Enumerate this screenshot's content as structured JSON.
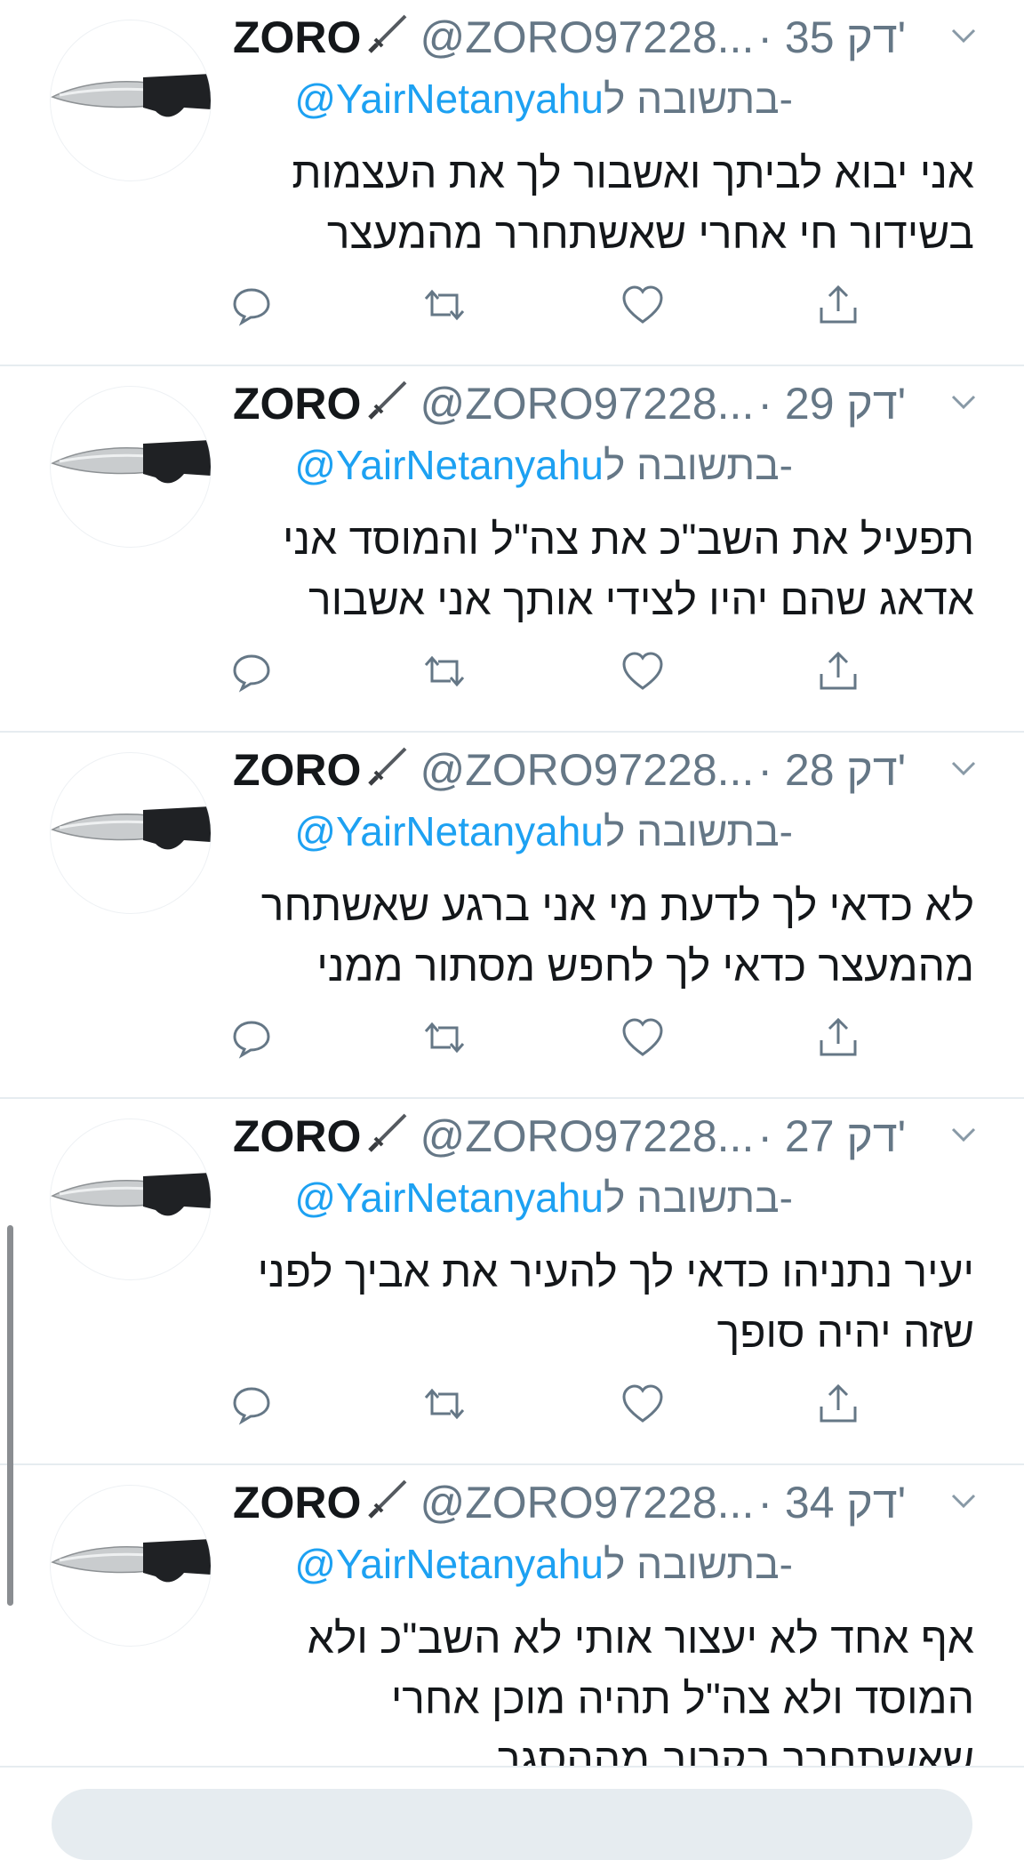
{
  "tweets": [
    {
      "name": "ZORO",
      "handle": "@ZORO97228...",
      "time": "· 35 דק'",
      "reply_prefix": "בתשובה ל-",
      "reply_mention": "@YairNetanyahu",
      "text": "אני יבוא לביתך ואשבור לך את העצמות בשידור חי אחרי שאשתחרר מהמעצר"
    },
    {
      "name": "ZORO",
      "handle": "@ZORO97228...",
      "time": "· 29 דק'",
      "reply_prefix": "בתשובה ל-",
      "reply_mention": "@YairNetanyahu",
      "text": "תפעיל את השב\"כ את צה\"ל והמוסד אני אדאג שהם יהיו לצידי אותך אני אשבור"
    },
    {
      "name": "ZORO",
      "handle": "@ZORO97228...",
      "time": "· 28 דק'",
      "reply_prefix": "בתשובה ל-",
      "reply_mention": "@YairNetanyahu",
      "text": "לא כדאי לך לדעת מי אני ברגע שאשתחר מהמעצר כדאי לך לחפש מסתור ממני"
    },
    {
      "name": "ZORO",
      "handle": "@ZORO97228...",
      "time": "· 27 דק'",
      "reply_prefix": "בתשובה ל-",
      "reply_mention": "@YairNetanyahu",
      "text": "יעיר נתניהו כדאי לך להעיר את אביך לפני שזה יהיה סופך"
    },
    {
      "name": "ZORO",
      "handle": "@ZORO97228...",
      "time": "· 34 דק'",
      "reply_prefix": "בתשובה ל-",
      "reply_mention": "@YairNetanyahu",
      "text": "אף אחד לא יעצור אותי לא השב\"כ ולא המוסד ולא צה\"ל תהיה מוכן אחרי שאשתחרר בקרוב מההסגר"
    }
  ],
  "icons": {
    "avatar": "knife-avatar-icon",
    "name_emoji": "dagger-icon",
    "menu": "chevron-down-icon",
    "reply": "reply-icon",
    "retweet": "retweet-icon",
    "like": "heart-icon",
    "share": "share-icon"
  },
  "colors": {
    "text": "#14171a",
    "secondary": "#657786",
    "link": "#1da1f2",
    "divider": "#e6ecf0"
  }
}
